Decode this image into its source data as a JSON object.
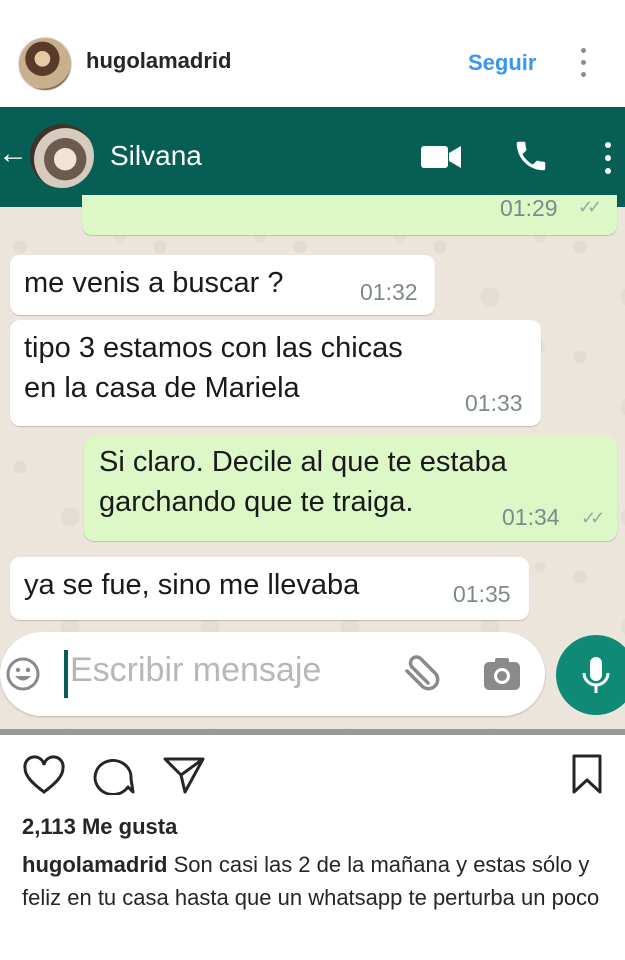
{
  "instagram": {
    "username": "hugolamadrid",
    "follow_label": "Seguir",
    "likes": "2,113 Me gusta",
    "caption_text": "Son casi las 2 de la mañana y estas sólo y feliz en tu casa hasta que un whatsapp te perturba un poco"
  },
  "whatsapp": {
    "contact_name": "Silvana",
    "header_color": "#075e54",
    "messages": [
      {
        "dir": "out",
        "text": "",
        "time": "01:29"
      },
      {
        "dir": "in",
        "text": "me venis a buscar ?",
        "time": "01:32"
      },
      {
        "dir": "in",
        "text": "tipo 3 estamos con las chicas\nen la casa de Mariela",
        "time": "01:33"
      },
      {
        "dir": "out",
        "text": "Si claro. Decile al que te estaba\ngarchando que te traiga.",
        "time": "01:34"
      },
      {
        "dir": "in",
        "text": "ya se fue, sino me llevaba",
        "time": "01:35"
      }
    ],
    "input_placeholder": "Escribir mensaje"
  },
  "icons": [
    "more-vertical-icon",
    "back-arrow-icon",
    "video-call-icon",
    "phone-icon",
    "emoji-icon",
    "attach-icon",
    "camera-icon",
    "mic-icon",
    "heart-icon",
    "comment-icon",
    "share-icon",
    "bookmark-icon"
  ],
  "colors": {
    "ig_link": "#3897f0",
    "wa_green": "#075e54",
    "wa_out_bubble": "#dcf8c6",
    "wa_mic": "#0e8a77"
  }
}
